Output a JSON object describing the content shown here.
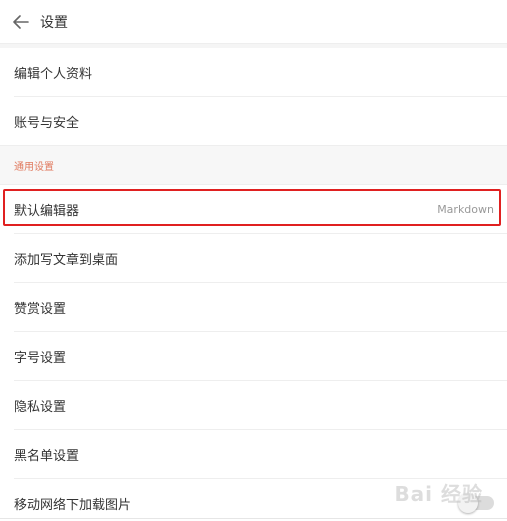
{
  "header": {
    "title": "设置",
    "back_icon": "arrow-left-icon"
  },
  "profile_items": [
    {
      "label": "编辑个人资料"
    },
    {
      "label": "账号与安全"
    }
  ],
  "general_section": {
    "title": "通用设置"
  },
  "general_items": [
    {
      "label": "默认编辑器",
      "value": "Markdown",
      "highlighted": true
    },
    {
      "label": "添加写文章到桌面"
    },
    {
      "label": "赞赏设置"
    },
    {
      "label": "字号设置"
    },
    {
      "label": "隐私设置"
    },
    {
      "label": "黑名单设置"
    },
    {
      "label": "移动网络下加载图片",
      "toggle": false
    }
  ],
  "watermark": {
    "text": "Bai  经验"
  },
  "colors": {
    "highlight_border": "#e02020",
    "section_title": "#e07a5f",
    "secondary_text": "#999999"
  }
}
